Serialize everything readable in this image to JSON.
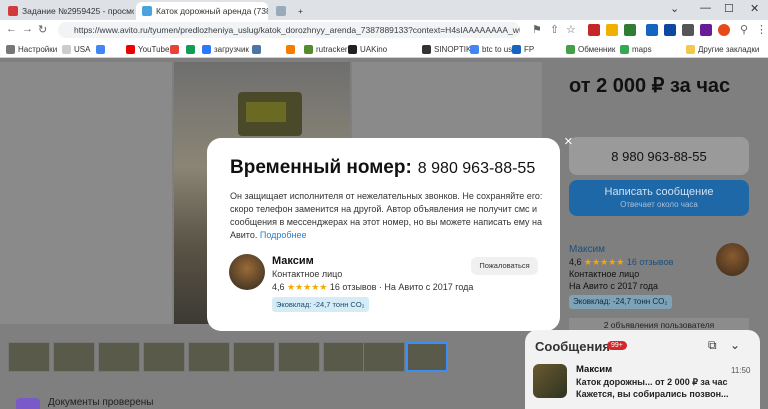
{
  "browser": {
    "tabs": [
      {
        "label": "Задание №2959425 - просмотр з"
      },
      {
        "label": "Каток дорожный аренда (7387889..."
      },
      {
        "label": ""
      }
    ],
    "url": "https://www.avito.ru/tyumen/predlozheniya_uslug/katok_dorozhnyy_arenda_7387889133?context=H4sIAAAAAAAA_wE_AMD_...",
    "bookmarks": [
      {
        "label": "Настройки"
      },
      {
        "label": "USA"
      },
      {
        "label": ""
      },
      {
        "label": "YouTube"
      },
      {
        "label": "M"
      },
      {
        "label": ""
      },
      {
        "label": "загрузчик"
      },
      {
        "label": ""
      },
      {
        "label": ""
      },
      {
        "label": "rutracker"
      },
      {
        "label": "UAKino"
      },
      {
        "label": ""
      },
      {
        "label": "SINOPTIK"
      },
      {
        "label": "btc to usd"
      },
      {
        "label": "FP"
      },
      {
        "label": "Обменник"
      },
      {
        "label": "maps"
      },
      {
        "label": "Другие закладки"
      }
    ],
    "ext_badges": {
      "ltc": "LTC",
      "ltc_value": "55.3",
      "red_badge": "53",
      "bal": "14"
    }
  },
  "listing": {
    "price": "от 2 000 ₽ за час",
    "phone": "8 980 963-88-55",
    "write_label": "Написать сообщение",
    "write_sub": "Отвечает около часа",
    "seller_name": "Максим",
    "seller_rating": "4,6",
    "seller_reviews": "16 отзывов",
    "seller_type": "Контактное лицо",
    "seller_since": "На Авито с 2017 года",
    "eco": "Эковклад: -24,7 тонн CO₂",
    "ads_count": "2 объявления пользователя",
    "docs": "Документы проверены"
  },
  "modal": {
    "title": "Временный номер:",
    "number": "8 980 963-88-55",
    "description": "Он защищает исполнителя от нежелательных звонков. Не сохраняйте его: скоро телефон заменится на другой. Автор объявления не получит смс и сообщения в мессенджерах на этот номер, но вы можете написать ему на Авито.",
    "more_link": "Подробнее",
    "seller_name": "Максим",
    "seller_type": "Контактное лицо",
    "rating": "4,6",
    "stars": "★★★★★",
    "reviews": "16 отзывов",
    "since": "· На Авито с 2017 года",
    "eco": "Эковклад: -24,7 тонн CO₂",
    "complain": "Пожаловаться",
    "close": "×"
  },
  "messages": {
    "title": "Сообщения",
    "count": "99+",
    "item": {
      "name": "Максим",
      "subject": "Каток дорожны... от 2 000 ₽ за час",
      "preview": "Кажется, вы собирались позвон...",
      "time": "11:50"
    }
  }
}
